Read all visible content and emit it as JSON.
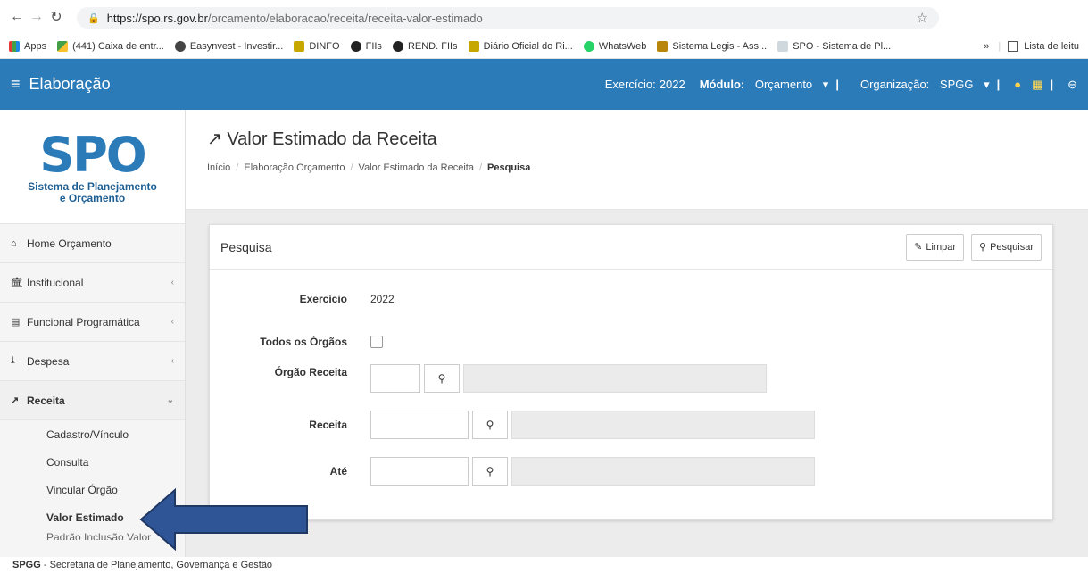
{
  "browser": {
    "url_host": "https://spo.rs.gov.br",
    "url_path": "/orcamento/elaboracao/receita/receita-valor-estimado",
    "bookmarks": [
      "Apps",
      "(441) Caixa de entr...",
      "Easynvest - Investir...",
      "DINFO",
      "FIIs",
      "REND. FIIs",
      "Diário Oficial do Ri...",
      "WhatsWeb",
      "Sistema Legis - Ass...",
      "SPO - Sistema de Pl..."
    ],
    "overflow": "»",
    "reading_list": "Lista de leitu"
  },
  "appbar": {
    "title": "Elaboração",
    "exercicio_label": "Exercício:",
    "exercicio_value": "2022",
    "modulo_label": "Módulo:",
    "modulo_value": "Orçamento",
    "organizacao_label": "Organização:",
    "organizacao_value": "SPGG"
  },
  "logo": {
    "text": "SPO",
    "line1": "Sistema de Planejamento",
    "line2": "e Orçamento"
  },
  "sidebar": {
    "items": [
      {
        "label": "Home Orçamento",
        "icon": "home-icon"
      },
      {
        "label": "Institucional",
        "icon": "bank-icon"
      },
      {
        "label": "Funcional Programática",
        "icon": "calendar-icon"
      },
      {
        "label": "Despesa",
        "icon": "download-icon"
      },
      {
        "label": "Receita",
        "icon": "external-link-icon"
      }
    ],
    "sub_items": [
      "Cadastro/Vínculo",
      "Consulta",
      "Vincular Órgão",
      "Valor Estimado",
      "Padrão Inclusão Valor"
    ]
  },
  "page": {
    "title": "Valor Estimado da Receita",
    "breadcrumb": [
      "Início",
      "Elaboração Orçamento",
      "Valor Estimado da Receita",
      "Pesquisa"
    ]
  },
  "panel": {
    "title": "Pesquisa",
    "clear_label": "Limpar",
    "search_label": "Pesquisar",
    "fields": {
      "exercicio_label": "Exercício",
      "exercicio_value": "2022",
      "todos_label": "Todos os Órgãos",
      "orgao_label": "Órgão Receita",
      "receita_label": "Receita",
      "ate_label": "Até"
    }
  },
  "footer": {
    "org": "SPGG",
    "text": " - Secretaria de Planejamento, Governança e Gestão"
  },
  "colors": {
    "primary": "#2b7bb9",
    "arrow": "#2f5597"
  }
}
